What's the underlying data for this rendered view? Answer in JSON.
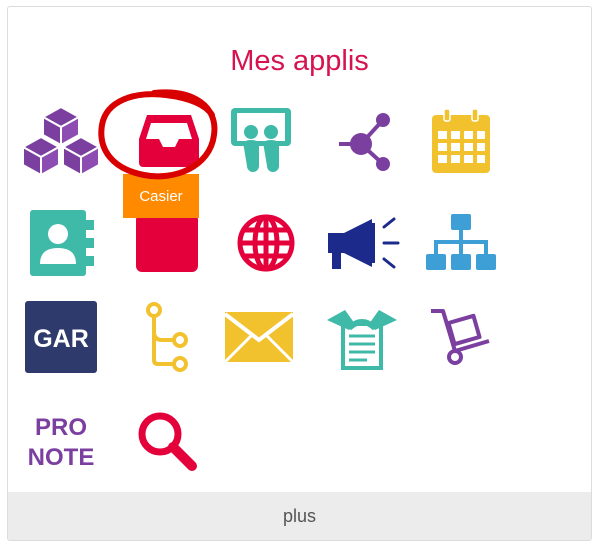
{
  "title": "Mes applis",
  "tooltip": "Casier",
  "footer": {
    "more_label": "plus"
  },
  "apps": [
    {
      "icon": "cubes-icon",
      "color": "#7b3fa0"
    },
    {
      "icon": "inbox-icon",
      "color": "#e4003b"
    },
    {
      "icon": "slideshare-icon",
      "color": "#3fb9a8"
    },
    {
      "icon": "share-nodes-icon",
      "color": "#7b3fa0"
    },
    {
      "icon": "calendar-icon",
      "color": "#f2c12e"
    },
    {
      "icon": "address-book-icon",
      "color": "#3fb9a8"
    },
    {
      "icon": "storage-box-icon",
      "color": "#e4003b"
    },
    {
      "icon": "globe-icon",
      "color": "#e4003b"
    },
    {
      "icon": "megaphone-icon",
      "color": "#1c2a8c"
    },
    {
      "icon": "sitemap-icon",
      "color": "#3e9ed6"
    },
    {
      "icon": "gar-logo-icon",
      "color": "#2d3a6b",
      "label": "GAR"
    },
    {
      "icon": "branch-icon",
      "color": "#f2c12e"
    },
    {
      "icon": "envelope-icon",
      "color": "#f2c12e"
    },
    {
      "icon": "contract-handshake-icon",
      "color": "#3fb9a8"
    },
    {
      "icon": "hand-truck-icon",
      "color": "#7b3fa0"
    },
    {
      "icon": "pronote-logo-icon",
      "color": "#7b3fa0",
      "label_top": "PRO",
      "label_bottom": "NOTE"
    },
    {
      "icon": "search-icon",
      "color": "#e4003b"
    }
  ]
}
